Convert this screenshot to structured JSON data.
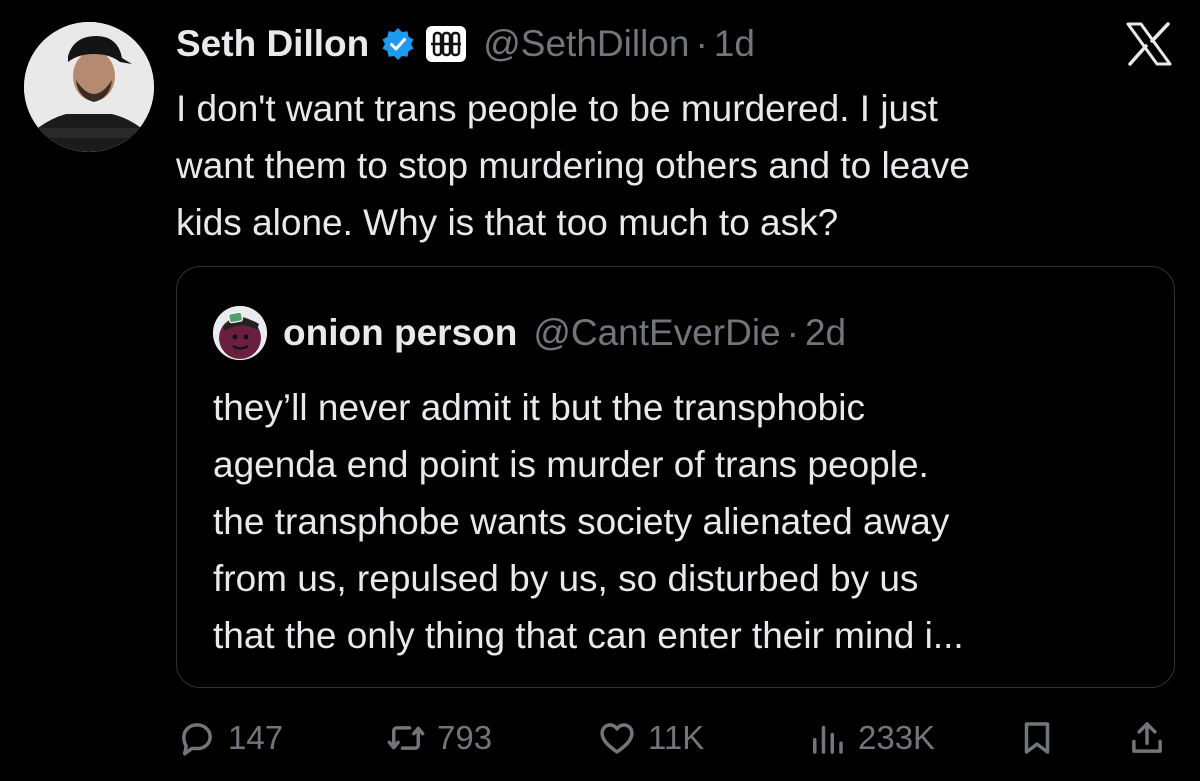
{
  "tweet": {
    "author_name": "Seth Dillon",
    "handle": "@SethDillon",
    "separator": "·",
    "time": "1d",
    "text_lines": [
      "I don't want trans people to be murdered. I just",
      "want them to stop murdering others and to leave",
      "kids alone. Why is that too much to ask?"
    ]
  },
  "quote": {
    "author_name": "onion person",
    "handle": "@CantEverDie",
    "separator": "·",
    "time": "2d",
    "text_lines": [
      "they’ll never admit it but the transphobic",
      "agenda end point is murder of trans people.",
      "the transphobe wants society alienated away",
      "from us, repulsed by us, so disturbed by us",
      "that the only thing that can enter their mind i..."
    ]
  },
  "actions": {
    "replies": "147",
    "reposts": "793",
    "likes": "11K",
    "views": "233K"
  },
  "icons": {
    "verified": "verified-badge-icon",
    "affiliation": "babylon-bee-affiliate-icon",
    "logo": "x-logo-icon",
    "reply": "reply-icon",
    "repost": "repost-icon",
    "like": "heart-icon",
    "views": "views-icon",
    "bookmark": "bookmark-icon",
    "share": "share-icon"
  },
  "colors": {
    "background": "#000000",
    "text": "#e7e9ea",
    "muted": "#71767b",
    "verified": "#1d9bf0",
    "border": "#2f3336"
  }
}
